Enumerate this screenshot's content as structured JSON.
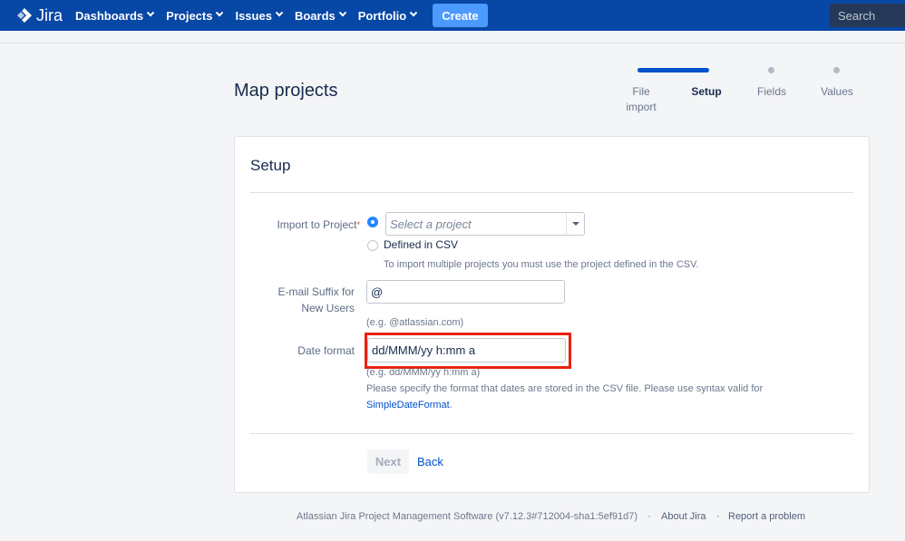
{
  "nav": {
    "logo": "Jira",
    "items": [
      "Dashboards",
      "Projects",
      "Issues",
      "Boards",
      "Portfolio"
    ],
    "create": "Create",
    "search_placeholder": "Search"
  },
  "page": {
    "title": "Map projects"
  },
  "tracker": {
    "steps": [
      {
        "label": "File import",
        "state": "done"
      },
      {
        "label": "Setup",
        "state": "current"
      },
      {
        "label": "Fields",
        "state": "todo"
      },
      {
        "label": "Values",
        "state": "todo"
      }
    ]
  },
  "form": {
    "title": "Setup",
    "import_label": "Import to Project",
    "import_required": "*",
    "select_placeholder": "Select a project",
    "option_select": "",
    "option_csv": "Defined in CSV",
    "csv_hint": "To import multiple projects you must use the project defined in the CSV.",
    "email_label_1": "E-mail Suffix for",
    "email_label_2": "New Users",
    "email_value": "@",
    "email_hint": "(e.g. @atlassian.com)",
    "date_label": "Date format",
    "date_value": "dd/MMM/yy h:mm a",
    "date_hint_1": "(e.g. dd/MMM/yy h:mm a)",
    "date_hint_2": "Please specify the format that dates are stored in the CSV file. Please use syntax valid for",
    "date_hint_link": "SimpleDateFormat",
    "date_hint_end": ".",
    "next": "Next",
    "back": "Back"
  },
  "footer": {
    "software": "Atlassian Jira Project Management Software (v7.12.3#712004-sha1:5ef91d7)",
    "about": "About Jira",
    "report": "Report a problem",
    "separator": "·"
  },
  "colors": {
    "nav_bg": "#0747a6",
    "create_bg": "#4c9aff",
    "highlight": "#e8220e",
    "link": "#0052cc"
  }
}
